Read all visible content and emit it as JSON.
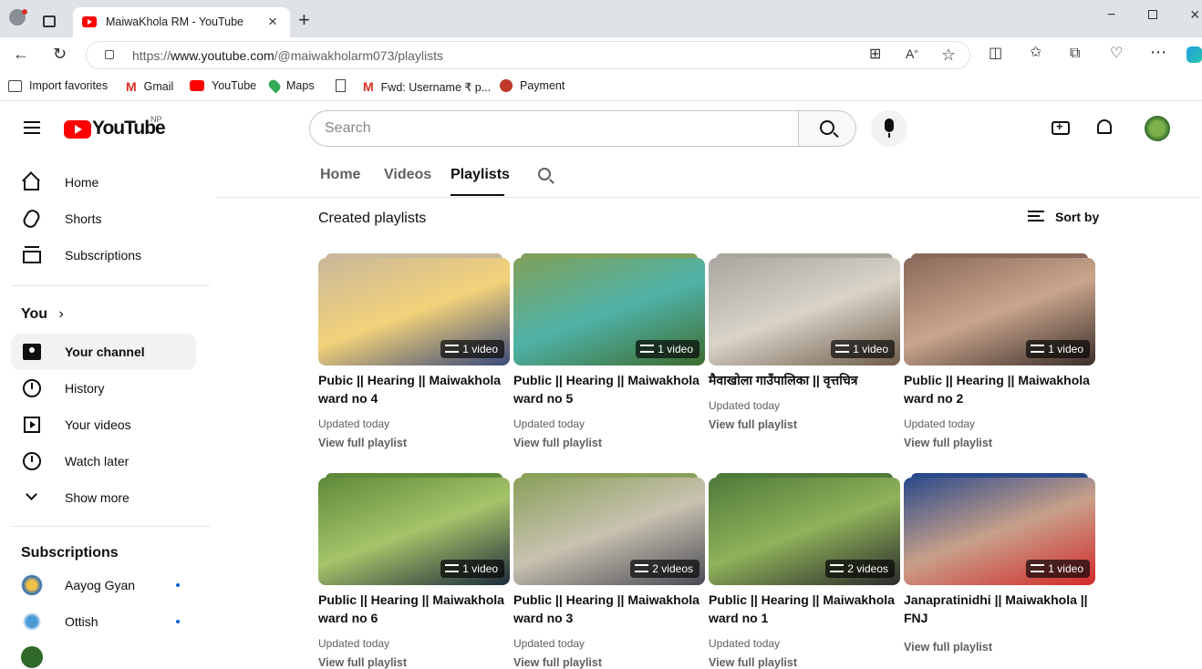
{
  "browser": {
    "tab_title": "MaiwaKhola RM - YouTube",
    "url_prefix": "https://",
    "url_domain": "www.youtube.com",
    "url_path": "/@maiwakholarm073/playlists",
    "favorites": [
      "Import favorites",
      "Gmail",
      "YouTube",
      "Maps",
      "Fwd: Username ₹ p...",
      "Payment"
    ]
  },
  "header": {
    "logo_text": "YouTube",
    "country_code": "NP",
    "search_placeholder": "Search"
  },
  "sidebar": {
    "main": [
      {
        "label": "Home",
        "icon": "home-icon"
      },
      {
        "label": "Shorts",
        "icon": "shorts-icon"
      },
      {
        "label": "Subscriptions",
        "icon": "subscriptions-icon"
      }
    ],
    "you_heading": "You",
    "you_items": [
      {
        "label": "Your channel",
        "icon": "channel-icon"
      },
      {
        "label": "History",
        "icon": "history-icon"
      },
      {
        "label": "Your videos",
        "icon": "video-icon"
      },
      {
        "label": "Watch later",
        "icon": "clock-icon"
      },
      {
        "label": "Show more",
        "icon": "chevron-down-icon"
      }
    ],
    "subscriptions_heading": "Subscriptions",
    "subscriptions": [
      {
        "label": "Aayog Gyan"
      },
      {
        "label": "Ottish"
      }
    ]
  },
  "channel_tabs": [
    "Home",
    "Videos",
    "Playlists"
  ],
  "section": {
    "title": "Created playlists",
    "sort_label": "Sort by"
  },
  "playlists": [
    {
      "title": "Pubic || Hearing || Maiwakhola ward no 4",
      "count": "1 video",
      "updated": "Updated today",
      "link": "View full playlist",
      "colors": [
        "#c9b89a",
        "#f3d27a",
        "#3a4a7a"
      ]
    },
    {
      "title": "Public || Hearing || Maiwakhola ward no 5",
      "count": "1 video",
      "updated": "Updated today",
      "link": "View full playlist",
      "colors": [
        "#7fa05a",
        "#4fb3a8",
        "#3e6b2f"
      ]
    },
    {
      "title": "मैवाखोला गाउँपालिका || वृत्तचित्र",
      "count": "1 video",
      "updated": "Updated today",
      "link": "View full playlist",
      "colors": [
        "#a9a6a0",
        "#d9d3c8",
        "#6d5c4a"
      ]
    },
    {
      "title": "Public || Hearing || Maiwakhola ward no 2",
      "count": "1 video",
      "updated": "Updated today",
      "link": "View full playlist",
      "colors": [
        "#8a6a5a",
        "#c9a58c",
        "#3a2e2a"
      ]
    },
    {
      "title": "Public || Hearing || Maiwakhola ward no 6",
      "count": "1 video",
      "updated": "Updated today",
      "link": "View full playlist",
      "colors": [
        "#5f8a3a",
        "#a5c46a",
        "#1e2a3a"
      ]
    },
    {
      "title": "Public || Hearing || Maiwakhola ward no 3",
      "count": "2 videos",
      "updated": "Updated today",
      "link": "View full playlist",
      "colors": [
        "#8aa05a",
        "#c8c2b0",
        "#4a4a55"
      ]
    },
    {
      "title": "Public || Hearing || Maiwakhola ward no 1",
      "count": "2 videos",
      "updated": "Updated today",
      "link": "View full playlist",
      "colors": [
        "#4f7a3a",
        "#8fb25a",
        "#2a2a2a"
      ]
    },
    {
      "title": "Janapratinidhi || Maiwakhola || FNJ",
      "count": "1 video",
      "updated": "",
      "link": "View full playlist",
      "colors": [
        "#2a4a8a",
        "#c8a08a",
        "#d22a2a"
      ]
    }
  ]
}
